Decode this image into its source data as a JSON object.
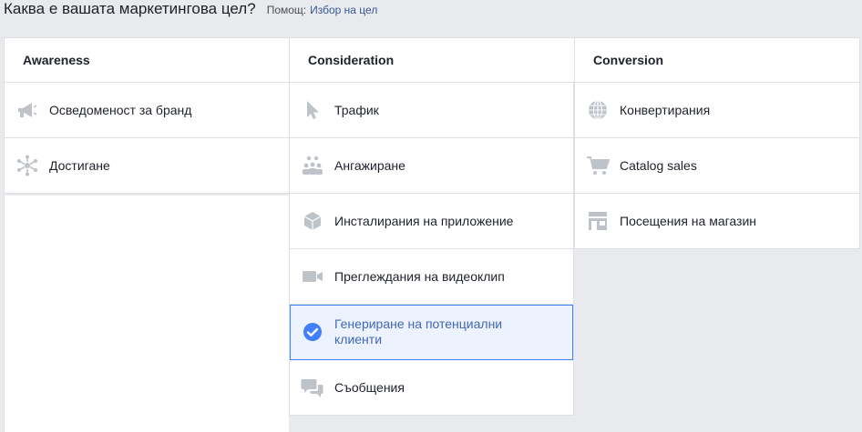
{
  "header": {
    "question": "Каква е вашата маркетингова цел?",
    "help_prefix": "Помощ:",
    "help_link": "Избор на цел"
  },
  "columns": [
    {
      "title": "Awareness",
      "items": [
        {
          "label": "Осведоменост за бранд",
          "icon": "megaphone-icon"
        },
        {
          "label": "Достигане",
          "icon": "reach-burst-icon"
        }
      ]
    },
    {
      "title": "Consideration",
      "items": [
        {
          "label": "Трафик",
          "icon": "cursor-icon"
        },
        {
          "label": "Ангажиране",
          "icon": "people-icon"
        },
        {
          "label": "Инсталирания на приложение",
          "icon": "cube-icon"
        },
        {
          "label": "Преглеждания на видеоклип",
          "icon": "video-camera-icon"
        },
        {
          "label": "Генериране на потенциални клиенти",
          "icon": "checkmark-icon",
          "selected": true
        },
        {
          "label": "Съобщения",
          "icon": "chat-bubbles-icon"
        }
      ]
    },
    {
      "title": "Conversion",
      "items": [
        {
          "label": "Конвертирания",
          "icon": "globe-icon"
        },
        {
          "label": "Catalog sales",
          "icon": "shopping-cart-icon"
        },
        {
          "label": "Посещения на магазин",
          "icon": "store-icon"
        }
      ]
    }
  ],
  "colors": {
    "icon": "#bec3c9",
    "selected_accent": "#4080ff",
    "selected_text": "#4267b2",
    "selected_bg": "#ecf3ff"
  }
}
